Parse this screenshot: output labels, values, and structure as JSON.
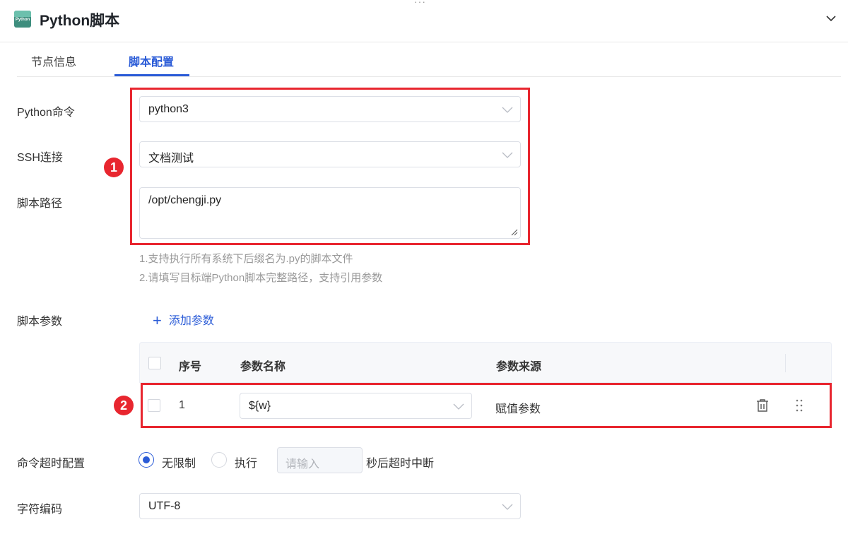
{
  "header": {
    "drag_handle": "···",
    "logo_text": "Python",
    "title": "Python脚本"
  },
  "tabs": [
    {
      "label": "节点信息",
      "active": false
    },
    {
      "label": "脚本配置",
      "active": true
    }
  ],
  "form": {
    "python_cmd": {
      "label": "Python命令",
      "value": "python3"
    },
    "ssh": {
      "label": "SSH连接",
      "value": "文档测试"
    },
    "script_path": {
      "label": "脚本路径",
      "value": "/opt/chengji.py"
    },
    "hints": [
      "1.支持执行所有系统下后缀名为.py的脚本文件",
      "2.请填写目标端Python脚本完整路径，支持引用参数"
    ],
    "params": {
      "label": "脚本参数",
      "add_label": "添加参数",
      "columns": [
        "序号",
        "参数名称",
        "参数来源"
      ],
      "rows": [
        {
          "index": "1",
          "name": "${w}",
          "source": "赋值参数"
        }
      ]
    },
    "timeout": {
      "label": "命令超时配置",
      "options": [
        "无限制",
        "执行"
      ],
      "selected": "无限制",
      "placeholder": "请输入",
      "suffix": "秒后超时中断"
    },
    "encoding": {
      "label": "字符编码",
      "value": "UTF-8"
    }
  },
  "annotations": {
    "badge1": "1",
    "badge2": "2"
  },
  "colors": {
    "accent": "#2a5bd7",
    "highlight": "#e8262f"
  }
}
